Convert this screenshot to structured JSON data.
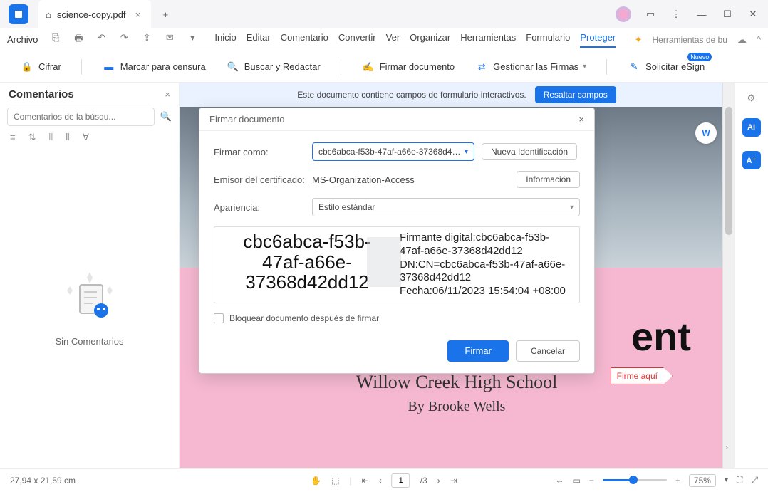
{
  "tab": {
    "title": "science-copy.pdf"
  },
  "menubar": {
    "file": "Archivo",
    "items": [
      "Inicio",
      "Editar",
      "Comentario",
      "Convertir",
      "Ver",
      "Organizar",
      "Herramientas",
      "Formulario",
      "Proteger"
    ],
    "active": "Proteger",
    "ai_tools": "Herramientas de bu"
  },
  "toolbar": {
    "encrypt": "Cifrar",
    "redact_mark": "Marcar para censura",
    "find_redact": "Buscar y Redactar",
    "sign_doc": "Firmar documento",
    "manage_sigs": "Gestionar las Firmas",
    "esign": "Solicitar eSign",
    "badge": "Nuevo"
  },
  "sidebar": {
    "title": "Comentarios",
    "search_placeholder": "Comentarios de la búsqu...",
    "empty": "Sin Comentarios"
  },
  "banner": {
    "text": "Este documento contiene campos de formulario interactivos.",
    "button": "Resaltar campos"
  },
  "dialog": {
    "title": "Firmar documento",
    "sign_as_label": "Firmar como:",
    "sign_as_value": "cbc6abca-f53b-47af-a66e-37368d42dd",
    "new_id": "Nueva Identificación",
    "issuer_label": "Emisor del certificado:",
    "issuer_value": "MS-Organization-Access",
    "info": "Información",
    "appearance_label": "Apariencia:",
    "appearance_value": "Estilo estándar",
    "preview_id_l1": "cbc6abca-f53b-",
    "preview_id_l2": "47af-a66e-",
    "preview_id_l3": "37368d42dd12",
    "preview_r1": "Firmante digital:cbc6abca-f53b-47af-a66e-37368d42dd12",
    "preview_r2": "DN:CN=cbc6abca-f53b-47af-a66e-37368d42dd12",
    "preview_r3": "Fecha:06/11/2023 15:54:04 +08:00",
    "lock_label": "Bloquear documento después de firmar",
    "sign": "Firmar",
    "cancel": "Cancelar"
  },
  "document": {
    "title_fragment": "ent",
    "subtitle1": "Willow Creek High School",
    "subtitle2": "By Brooke Wells",
    "sign_here": "Firme aquí"
  },
  "status": {
    "coords": "27,94 x 21,59 cm",
    "page_current": "1",
    "page_total": "/3",
    "zoom": "75%"
  }
}
